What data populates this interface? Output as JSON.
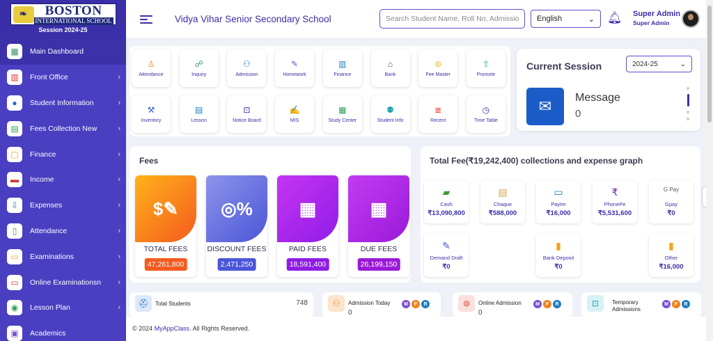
{
  "logo": {
    "name_line1": "BOSTON",
    "name_line2": "INTERNATIONAL SCHOOL",
    "session": "Session 2024-25"
  },
  "sidebar": {
    "items": [
      {
        "label": "Main Dashboard",
        "icon": "dashboard-icon",
        "active": true,
        "chevron": false
      },
      {
        "label": "Front Office",
        "icon": "books-icon",
        "active": false,
        "chevron": true
      },
      {
        "label": "Student Information",
        "icon": "person-icon",
        "active": false,
        "chevron": true
      },
      {
        "label": "Fees Collection New",
        "icon": "calculator-icon",
        "active": false,
        "chevron": true
      },
      {
        "label": "Finance",
        "icon": "document-icon",
        "active": false,
        "chevron": true
      },
      {
        "label": "Income",
        "icon": "money-icon",
        "active": false,
        "chevron": true
      },
      {
        "label": "Expenses",
        "icon": "download-icon",
        "active": false,
        "chevron": true
      },
      {
        "label": "Attendance",
        "icon": "notebook-icon",
        "active": false,
        "chevron": true
      },
      {
        "label": "Examinations",
        "icon": "laptop-icon",
        "active": false,
        "chevron": true
      },
      {
        "label": "Online Examinationsn",
        "icon": "monitor-icon",
        "active": false,
        "chevron": true
      },
      {
        "label": "Lesson Plan",
        "icon": "compass-icon",
        "active": false,
        "chevron": true
      },
      {
        "label": "Academics",
        "icon": "academics-icon",
        "active": false,
        "chevron": false
      }
    ]
  },
  "header": {
    "school_name": "Vidya Vihar Senior Secondary School",
    "search_placeholder": "Search Student Name, Roll No, Admission",
    "language": "English",
    "user_name": "Super Admin",
    "user_role": "Super Admin"
  },
  "quick_links": [
    {
      "label": "Attendance",
      "icon": "attendance-icon",
      "color": "#f0831e"
    },
    {
      "label": "Inquiry",
      "icon": "inquiry-icon",
      "color": "#2e9e5b"
    },
    {
      "label": "Admission",
      "icon": "admission-icon",
      "color": "#1b7fc4"
    },
    {
      "label": "Homework",
      "icon": "homework-icon",
      "color": "#7a4fd1"
    },
    {
      "label": "Finance",
      "icon": "finance-icon",
      "color": "#1b7fc4"
    },
    {
      "label": "Bank",
      "icon": "bank-icon",
      "color": "#555555"
    },
    {
      "label": "Fee Master",
      "icon": "fee-master-icon",
      "color": "#f2b31b"
    },
    {
      "label": "Promote",
      "icon": "promote-icon",
      "color": "#18a4a8"
    },
    {
      "label": "Inventory",
      "icon": "inventory-icon",
      "color": "#3a5bc9"
    },
    {
      "label": "Lesson",
      "icon": "lesson-icon",
      "color": "#1b7fc4"
    },
    {
      "label": "Notice Board",
      "icon": "notice-board-icon",
      "color": "#3a2fa8"
    },
    {
      "label": "MIS",
      "icon": "mis-icon",
      "color": "#f0831e"
    },
    {
      "label": "Study Center",
      "icon": "study-center-icon",
      "color": "#2e9e5b"
    },
    {
      "label": "Student Info",
      "icon": "student-info-icon",
      "color": "#18a4a8"
    },
    {
      "label": "Recent",
      "icon": "recent-icon",
      "color": "#e5392d"
    },
    {
      "label": "Time Table",
      "icon": "time-table-icon",
      "color": "#3a2fa8"
    }
  ],
  "session_card": {
    "title": "Current Session",
    "selected": "2024-25",
    "message_title": "Message",
    "message_count": "0"
  },
  "fees": {
    "title": "Fees",
    "cards": [
      {
        "label": "TOTAL FEES",
        "value": "47,261,800",
        "color": "#f55a1e",
        "color2": "#ffb21a"
      },
      {
        "label": "DISCOUNT FEES",
        "value": "2,471,250",
        "color": "#4b56d8",
        "color2": "#8c94ea"
      },
      {
        "label": "PAID FEES",
        "value": "18,591,400",
        "color": "#8f1ce6",
        "color2": "#c535f2"
      },
      {
        "label": "DUE FEES",
        "value": "26,199,150",
        "color": "#9a1ad8",
        "color2": "#c13cf3"
      }
    ]
  },
  "collections": {
    "title": "Total Fee(₹19,242,400) collections and expense graph",
    "methods": [
      {
        "label": "Cash",
        "value": "₹13,090,800",
        "icon": "cash-icon"
      },
      {
        "label": "Chaque",
        "value": "₹588,000",
        "icon": "cheque-icon"
      },
      {
        "label": "Paytm",
        "value": "₹16,000",
        "icon": "paytm-icon"
      },
      {
        "label": "PhonePe",
        "value": "₹5,531,600",
        "icon": "phonepe-icon"
      },
      {
        "label": "Gpay",
        "value": "₹0",
        "icon": "gpay-icon",
        "icon_text": "G Pay"
      },
      {
        "label": "Demand Draft",
        "value": "₹0",
        "icon": "demand-draft-icon"
      },
      {
        "label": "Bank Deposit",
        "value": "₹0",
        "icon": "bank-deposit-icon"
      },
      {
        "label": "Other",
        "value": "₹16,000",
        "icon": "other-icon"
      }
    ]
  },
  "stats": [
    {
      "label": "Total Students",
      "value": "748",
      "icon": "student-cap-icon"
    },
    {
      "label": "Admission Today",
      "value": "0",
      "icon": "admission-today-icon",
      "chips": [
        "M",
        "F",
        "R"
      ]
    },
    {
      "label": "Online Admission",
      "value": "0",
      "icon": "online-admission-icon",
      "chips": [
        "M",
        "F",
        "R"
      ]
    },
    {
      "label": "Temporary Admissions",
      "value": "",
      "icon": "temporary-admission-icon",
      "chips": [
        "M",
        "F",
        "R"
      ]
    }
  ],
  "footer": {
    "prefix": "© 2024 ",
    "link": "MyAppClass",
    "suffix": ". All Rights Reserved."
  }
}
